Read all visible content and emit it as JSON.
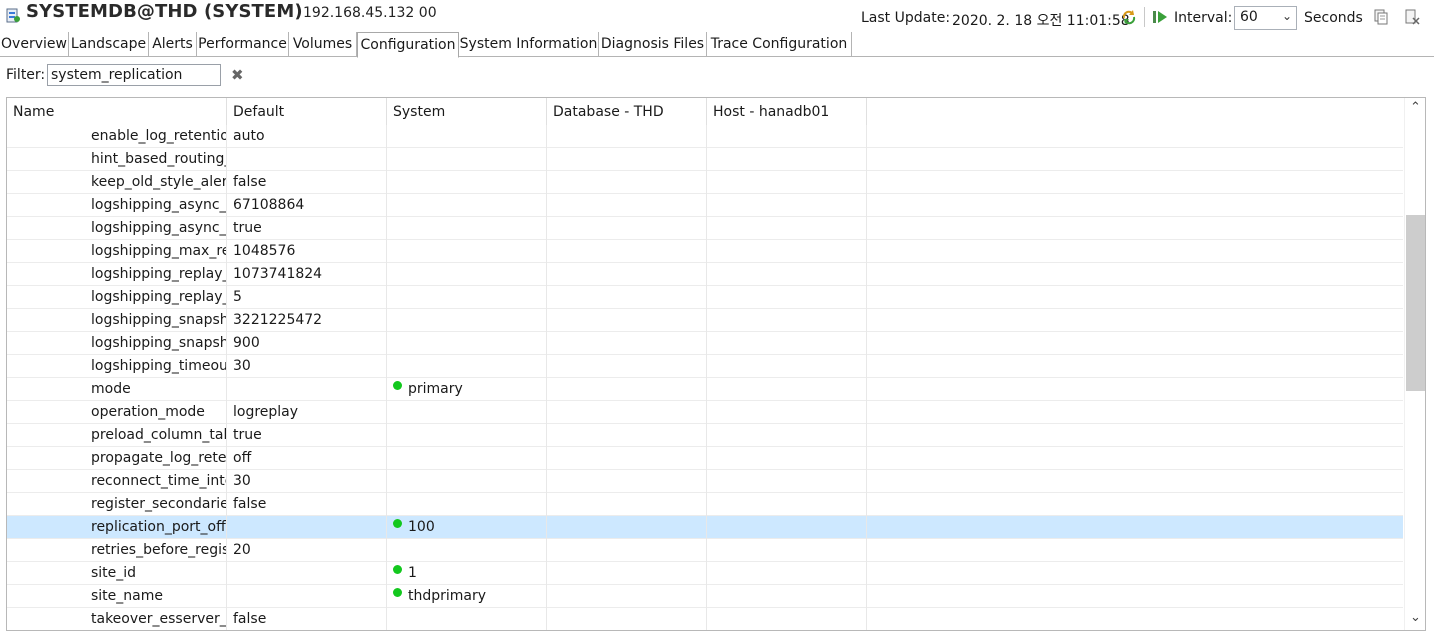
{
  "header": {
    "title": "SYSTEMDB@THD (SYSTEM)",
    "host": "192.168.45.132 00",
    "last_update_label": "Last Update:",
    "last_update_value": "2020. 2. 18 오전 11:01:58",
    "interval_label": "Interval:",
    "interval_value": "60",
    "seconds_label": "Seconds"
  },
  "tabs": [
    {
      "label": "Overview"
    },
    {
      "label": "Landscape"
    },
    {
      "label": "Alerts"
    },
    {
      "label": "Performance"
    },
    {
      "label": "Volumes"
    },
    {
      "label": "Configuration",
      "active": true
    },
    {
      "label": "System Information"
    },
    {
      "label": "Diagnosis Files"
    },
    {
      "label": "Trace Configuration"
    }
  ],
  "filter": {
    "label": "Filter:",
    "value": "system_replication"
  },
  "table": {
    "columns": [
      "Name",
      "Default",
      "System",
      "Database - THD",
      "Host - hanadb01"
    ],
    "rows": [
      {
        "name": "enable_log_retention",
        "default": "auto",
        "system": "",
        "system_dot": false
      },
      {
        "name": "hint_based_routing_",
        "default": "",
        "system": "",
        "system_dot": false
      },
      {
        "name": "keep_old_style_alert",
        "default": "false",
        "system": "",
        "system_dot": false
      },
      {
        "name": "logshipping_async_b",
        "default": "67108864",
        "system": "",
        "system_dot": false
      },
      {
        "name": "logshipping_async_w",
        "default": "true",
        "system": "",
        "system_dot": false
      },
      {
        "name": "logshipping_max_re",
        "default": "1048576",
        "system": "",
        "system_dot": false
      },
      {
        "name": "logshipping_replay_",
        "default": "1073741824",
        "system": "",
        "system_dot": false
      },
      {
        "name": "logshipping_replay_",
        "default": "5",
        "system": "",
        "system_dot": false
      },
      {
        "name": "logshipping_snapsh",
        "default": "3221225472",
        "system": "",
        "system_dot": false
      },
      {
        "name": "logshipping_snapsh",
        "default": "900",
        "system": "",
        "system_dot": false
      },
      {
        "name": "logshipping_timeou",
        "default": "30",
        "system": "",
        "system_dot": false
      },
      {
        "name": "mode",
        "default": "",
        "system": "primary",
        "system_dot": true
      },
      {
        "name": "operation_mode",
        "default": "logreplay",
        "system": "",
        "system_dot": false
      },
      {
        "name": "preload_column_tab",
        "default": "true",
        "system": "",
        "system_dot": false
      },
      {
        "name": "propagate_log_reter",
        "default": "off",
        "system": "",
        "system_dot": false
      },
      {
        "name": "reconnect_time_inte",
        "default": "30",
        "system": "",
        "system_dot": false
      },
      {
        "name": "register_secondaries",
        "default": "false",
        "system": "",
        "system_dot": false
      },
      {
        "name": "replication_port_offs",
        "default": "",
        "system": "100",
        "system_dot": true,
        "selected": true
      },
      {
        "name": "retries_before_regist",
        "default": "20",
        "system": "",
        "system_dot": false
      },
      {
        "name": "site_id",
        "default": "",
        "system": "1",
        "system_dot": true
      },
      {
        "name": "site_name",
        "default": "",
        "system": "thdprimary",
        "system_dot": true
      },
      {
        "name": "takeover_esserver_w",
        "default": "false",
        "system": "",
        "system_dot": false
      }
    ]
  },
  "colors": {
    "selected_row": "#cde8ff",
    "status_dot": "#13c81e",
    "scroll_thumb": "#cdcdcd"
  },
  "icons": [
    "database-icon",
    "refresh-icon",
    "play-icon",
    "chevron-down-icon",
    "copy-icon",
    "export-icon",
    "clear-filter-icon",
    "sort-caret-icon",
    "scroll-up-icon",
    "scroll-down-icon"
  ]
}
